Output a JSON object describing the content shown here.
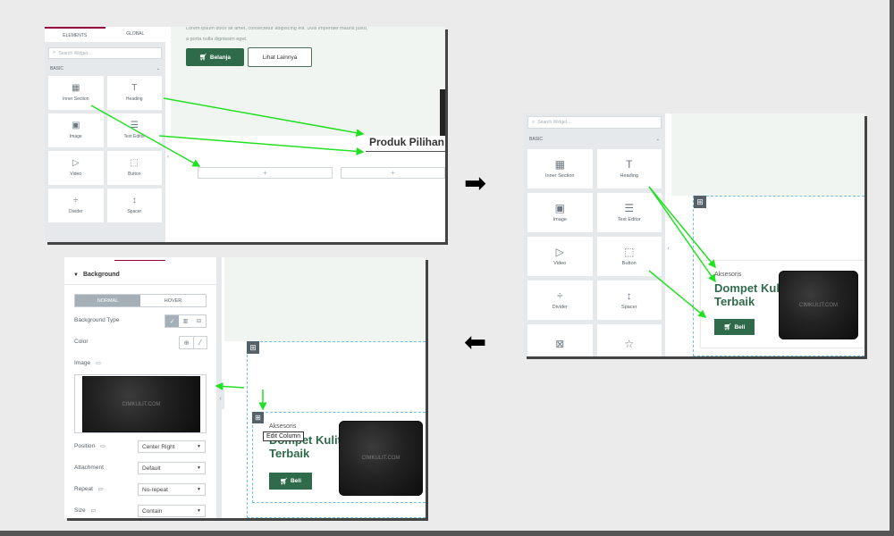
{
  "colors": {
    "accent_green": "#2f6b4b",
    "arrow_green": "#22e022",
    "tab_active": "#93003c",
    "editor_bg": "#e6e9ec"
  },
  "panel1": {
    "tabs": [
      "ELEMENTS",
      "GLOBAL"
    ],
    "search_placeholder": "Search Widget...",
    "section": "BASIC",
    "widgets": [
      {
        "label": "Inner Section",
        "icon": "columns-icon",
        "glyph": "▦"
      },
      {
        "label": "Heading",
        "icon": "heading-icon",
        "glyph": "T"
      },
      {
        "label": "Image",
        "icon": "image-icon",
        "glyph": "▣"
      },
      {
        "label": "Text Editor",
        "icon": "text-editor-icon",
        "glyph": "☰"
      },
      {
        "label": "Video",
        "icon": "video-icon",
        "glyph": "▷"
      },
      {
        "label": "Button",
        "icon": "button-icon",
        "glyph": "⬚"
      },
      {
        "label": "Divider",
        "icon": "divider-icon",
        "glyph": "÷"
      },
      {
        "label": "Spacer",
        "icon": "spacer-icon",
        "glyph": "↕"
      }
    ],
    "lorem_line1": "Lorem ipsum dolor sit amet, consectetur adipiscing elit. Duis imperdiet mauris justo,",
    "lorem_line2": "a porta nulla dignissim eget.",
    "btn_primary": "Belanja",
    "btn_secondary": "Lihat Lainnya",
    "heading": "Produk Pilihan",
    "add": "+"
  },
  "panel2": {
    "search_placeholder": "Search Widget...",
    "section": "BASIC",
    "widgets": [
      {
        "label": "Inner Section",
        "icon": "columns-icon",
        "glyph": "▦"
      },
      {
        "label": "Heading",
        "icon": "heading-icon",
        "glyph": "T"
      },
      {
        "label": "Image",
        "icon": "image-icon",
        "glyph": "▣"
      },
      {
        "label": "Text Editor",
        "icon": "text-editor-icon",
        "glyph": "☰"
      },
      {
        "label": "Video",
        "icon": "video-icon",
        "glyph": "▷"
      },
      {
        "label": "Button",
        "icon": "button-icon",
        "glyph": "⬚"
      },
      {
        "label": "Divider",
        "icon": "divider-icon",
        "glyph": "÷"
      },
      {
        "label": "Spacer",
        "icon": "spacer-icon",
        "glyph": "↕"
      },
      {
        "label": "",
        "icon": "image-gallery-icon",
        "glyph": "⊠"
      },
      {
        "label": "",
        "icon": "star-icon",
        "glyph": "☆"
      }
    ],
    "card_subtitle": "Aksesoris",
    "card_title_1": "Dompet Kulit",
    "card_title_2": "Terbaik",
    "card_button": "Beli",
    "watermark": "CIMKULIT.COM"
  },
  "panel3": {
    "section": "Background",
    "tabs": [
      "NORMAL",
      "HOVER"
    ],
    "bg_type_label": "Background Type",
    "color_label": "Color",
    "image_label": "Image",
    "watermark": "CIMKULIT.COM",
    "position_label": "Position",
    "position_value": "Center Right",
    "attachment_label": "Attachment",
    "attachment_value": "Default",
    "repeat_label": "Repeat",
    "repeat_value": "No-repeat",
    "size_label": "Size",
    "size_value": "Contain",
    "tooltip": "Edit Column",
    "card_subtitle": "Aksesoris",
    "card_title_1": "Dompet Kulit",
    "card_title_2": "Terbaik",
    "card_button": "Beli"
  }
}
